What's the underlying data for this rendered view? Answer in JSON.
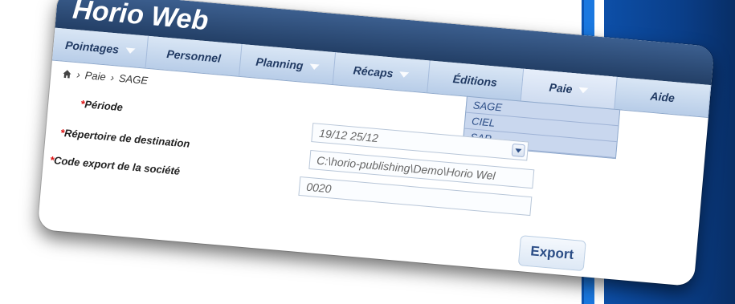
{
  "app": {
    "title": "Horio Web"
  },
  "nav": {
    "tabs": [
      {
        "label": "Pointages",
        "has_dropdown": true
      },
      {
        "label": "Personnel",
        "has_dropdown": false
      },
      {
        "label": "Planning",
        "has_dropdown": true
      },
      {
        "label": "Récaps",
        "has_dropdown": true
      },
      {
        "label": "Éditions",
        "has_dropdown": false
      },
      {
        "label": "Paie",
        "has_dropdown": true,
        "active": true
      },
      {
        "label": "Aide",
        "has_dropdown": false
      }
    ]
  },
  "breadcrumb": {
    "items": [
      "Paie",
      "SAGE"
    ]
  },
  "submenu": {
    "items": [
      "SAGE",
      "CIEL",
      "SAP"
    ]
  },
  "form": {
    "required_marker": "*",
    "periode": {
      "label": "Période",
      "value": "19/12 25/12"
    },
    "repertoire": {
      "label": "Répertoire de destination",
      "value": "C:\\horio-publishing\\Demo\\Horio Wel"
    },
    "code_export": {
      "label": "Code export de la société",
      "value": "0020"
    }
  },
  "actions": {
    "export_label": "Export"
  },
  "colors": {
    "header": "#2f5078",
    "nav": "#c9d9ee",
    "accent": "#2b4d86",
    "required": "#dd1111"
  }
}
